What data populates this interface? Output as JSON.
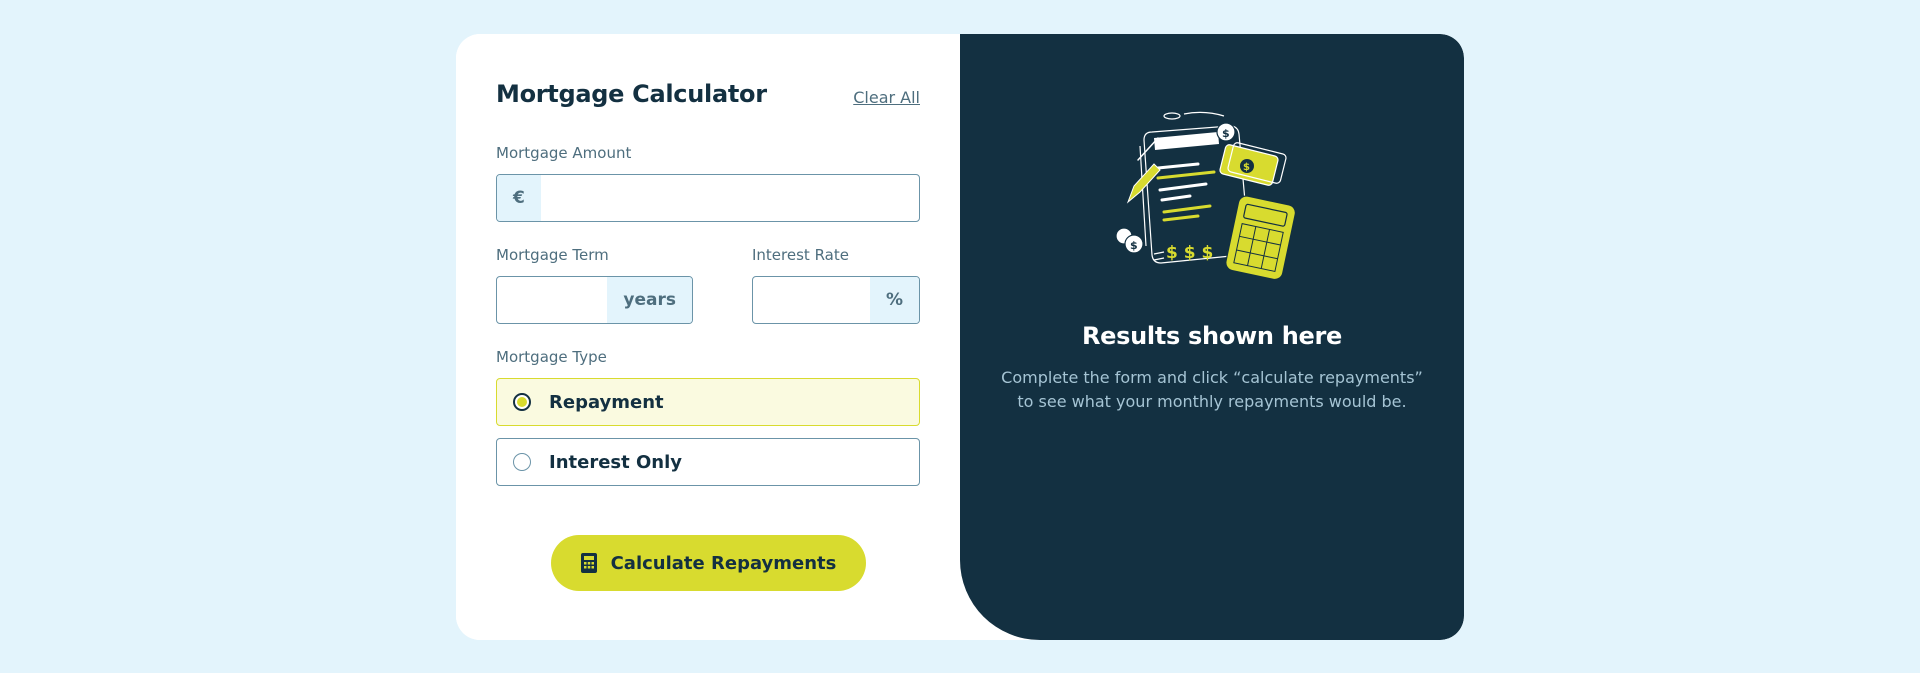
{
  "form": {
    "title": "Mortgage Calculator",
    "clear_all": "Clear All",
    "amount": {
      "label": "Mortgage Amount",
      "prefix": "€",
      "value": "",
      "placeholder": ""
    },
    "term": {
      "label": "Mortgage Term",
      "suffix": "years",
      "value": "",
      "placeholder": ""
    },
    "rate": {
      "label": "Interest Rate",
      "suffix": "%",
      "value": "",
      "placeholder": ""
    },
    "type": {
      "label": "Mortgage Type",
      "options": [
        {
          "label": "Repayment",
          "selected": true
        },
        {
          "label": "Interest Only",
          "selected": false
        }
      ]
    },
    "submit_label": "Calculate Repayments",
    "submit_icon": "calculator-icon"
  },
  "results": {
    "illustration": "empty-results-illustration",
    "title": "Results shown here",
    "text": "Complete the form and click “calculate repayments” to see what your monthly repayments would be."
  },
  "colors": {
    "page_bg": "#e3f4fc",
    "dark": "#133041",
    "accent_lime": "#d8db2f",
    "muted": "#4e6e7e",
    "border": "#6b94a8",
    "selected_bg": "#fafae0"
  }
}
